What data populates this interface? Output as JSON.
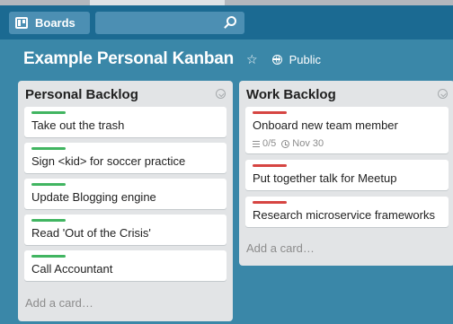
{
  "colors": {
    "header_bg": "#1b6a92",
    "board_bg": "#3a87a8",
    "list_bg": "#e2e4e6",
    "label_green": "#41b561",
    "label_red": "#d64542"
  },
  "header": {
    "boards_label": "Boards",
    "boards_icon": "boards-icon",
    "search_value": "",
    "search_icon": "search-icon"
  },
  "board": {
    "title": "Example Personal Kanban",
    "star_icon": "star-icon",
    "visibility_icon": "globe-icon",
    "visibility_label": "Public"
  },
  "lists": [
    {
      "title": "Personal Backlog",
      "cards": [
        {
          "label_color": "#41b561",
          "text": "Take out the trash"
        },
        {
          "label_color": "#41b561",
          "text": "Sign <kid> for soccer practice"
        },
        {
          "label_color": "#41b561",
          "text": "Update Blogging engine"
        },
        {
          "label_color": "#41b561",
          "text": "Read 'Out of the Crisis'"
        },
        {
          "label_color": "#41b561",
          "text": "Call Accountant"
        }
      ],
      "add_card_label": "Add a card…"
    },
    {
      "title": "Work Backlog",
      "cards": [
        {
          "label_color": "#d64542",
          "text": "Onboard new team member",
          "checklist": "0/5",
          "due": "Nov 30"
        },
        {
          "label_color": "#d64542",
          "text": "Put together talk for Meetup"
        },
        {
          "label_color": "#d64542",
          "text": "Research microservice frameworks"
        }
      ],
      "add_card_label": "Add a card…"
    }
  ]
}
